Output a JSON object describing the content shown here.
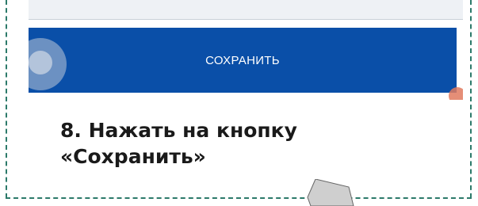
{
  "screenshot": {
    "save_button_label": "СОХРАНИТЬ",
    "colors": {
      "button_bg": "#0a4fa8",
      "button_text": "#ffffff",
      "frame_dash": "#2c7a6a"
    }
  },
  "instruction": {
    "line1": "8. Нажать на кнопку",
    "line2": "«Сохранить»"
  },
  "icons": {
    "touch_indicator": "touch-circle-icon",
    "tab_shape": "callout-tab-icon"
  }
}
